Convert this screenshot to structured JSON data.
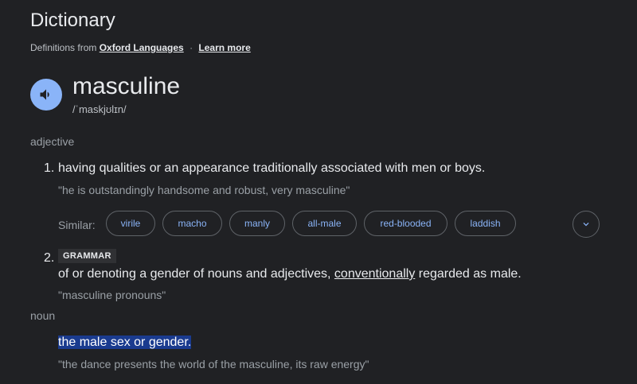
{
  "header": {
    "title": "Dictionary",
    "source_prefix": "Definitions from",
    "source_link": "Oxford Languages",
    "separator": "·",
    "learn_more": "Learn more"
  },
  "entry": {
    "headword": "masculine",
    "phonetic": "/ˈmaskjʊlɪn/",
    "speaker_icon": "volume-icon"
  },
  "adjective": {
    "label": "adjective",
    "senses": [
      {
        "number": "1.",
        "definition": "having qualities or an appearance traditionally associated with men or boys.",
        "example": "\"he is outstandingly handsome and robust, very masculine\"",
        "similar_label": "Similar:",
        "similar": [
          "virile",
          "macho",
          "manly",
          "all-male",
          "red-blooded",
          "laddish"
        ]
      },
      {
        "number": "2.",
        "tag": "GRAMMAR",
        "definition_before": "of or denoting a gender of nouns and adjectives, ",
        "definition_link": "conventionally",
        "definition_after": " regarded as male.",
        "example": "\"masculine pronouns\""
      }
    ]
  },
  "noun": {
    "label": "noun",
    "definition": "the male sex or gender.",
    "example": "\"the dance presents the world of the masculine, its raw energy\""
  },
  "colors": {
    "background": "#202124",
    "accent": "#8ab4f8",
    "highlight": "#1a3b8f"
  }
}
